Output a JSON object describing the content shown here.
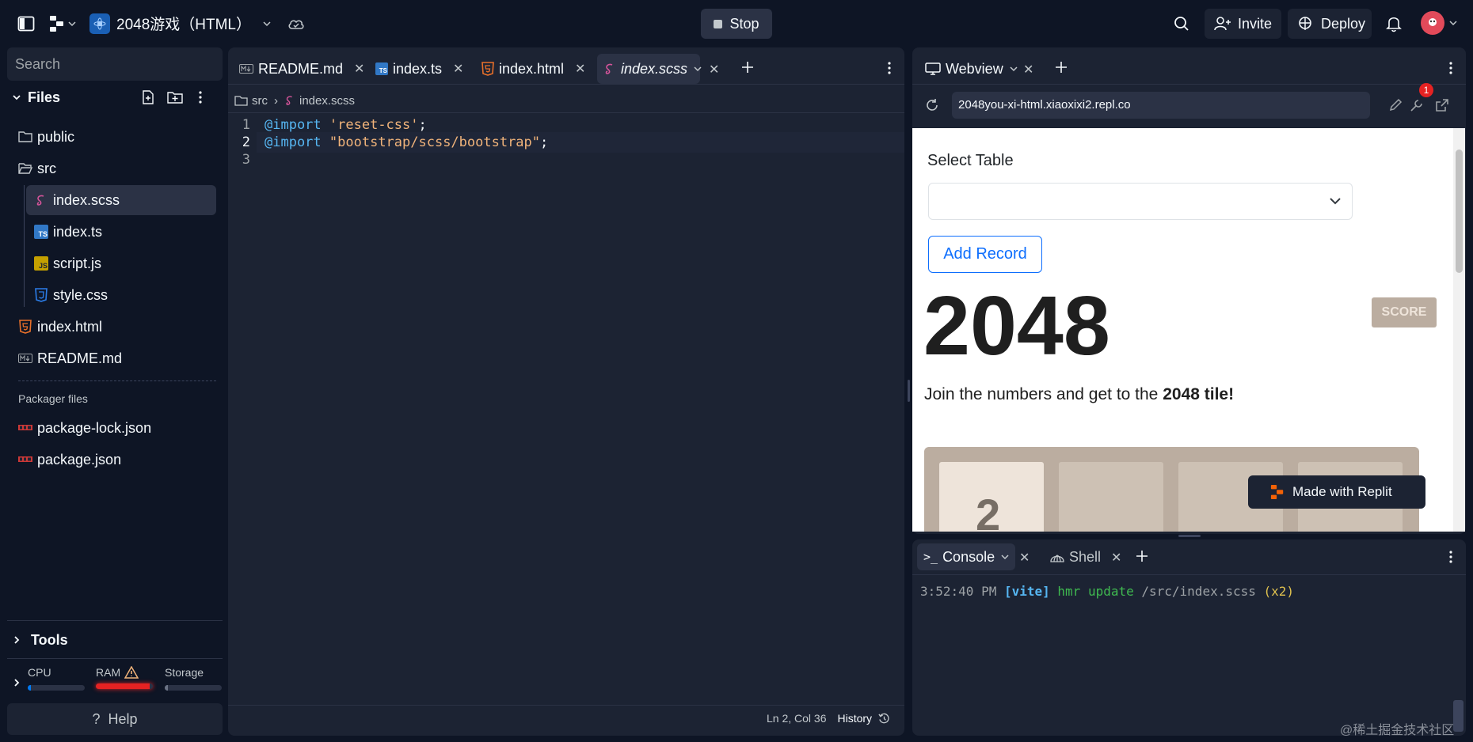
{
  "topbar": {
    "project_name": "2048游戏（HTML）",
    "stop_label": "Stop",
    "invite_label": "Invite",
    "deploy_label": "Deploy"
  },
  "sidebar": {
    "search_placeholder": "Search",
    "files_label": "Files",
    "items": [
      {
        "label": "public",
        "icon": "folder-icon"
      },
      {
        "label": "src",
        "icon": "folder-open-icon"
      },
      {
        "label": "index.scss",
        "icon": "sass-icon"
      },
      {
        "label": "index.ts",
        "icon": "typescript-icon"
      },
      {
        "label": "script.js",
        "icon": "javascript-icon"
      },
      {
        "label": "style.css",
        "icon": "css-icon"
      },
      {
        "label": "index.html",
        "icon": "html-icon"
      },
      {
        "label": "README.md",
        "icon": "markdown-icon"
      }
    ],
    "packager_label": "Packager files",
    "packager_items": [
      {
        "label": "package-lock.json",
        "icon": "npm-icon"
      },
      {
        "label": "package.json",
        "icon": "npm-icon"
      }
    ],
    "tools_label": "Tools",
    "cpu_label": "CPU",
    "ram_label": "RAM",
    "storage_label": "Storage",
    "cpu_usage": 0.06,
    "ram_usage": 0.95,
    "storage_usage": 0.05,
    "help_label": "Help"
  },
  "editor": {
    "tabs": [
      {
        "label": "README.md",
        "icon": "markdown-icon"
      },
      {
        "label": "index.ts",
        "icon": "typescript-icon"
      },
      {
        "label": "index.html",
        "icon": "html-icon"
      },
      {
        "label": "index.scss",
        "icon": "sass-icon",
        "active": true
      }
    ],
    "breadcrumb": {
      "folder": "src",
      "file": "index.scss"
    },
    "lines": [
      {
        "num": "1",
        "kw": "@import",
        "str": "'reset-css'",
        "end": ";"
      },
      {
        "num": "2",
        "kw": "@import",
        "str": "\"bootstrap/scss/bootstrap\"",
        "end": ";"
      },
      {
        "num": "3",
        "kw": "",
        "str": "",
        "end": ""
      }
    ],
    "status_position": "Ln 2, Col 36",
    "status_history": "History"
  },
  "webview": {
    "tab_label": "Webview",
    "url": "2048you-xi-html.xiaoxixi2.repl.co",
    "badge_count": "1",
    "select_label": "Select Table",
    "add_record_label": "Add Record",
    "game_title": "2048",
    "score_label": "SCORE",
    "intro_text": "Join the numbers and get to the",
    "intro_bold": "2048 tile!",
    "tile_value": "2",
    "made_with_label": "Made with Replit"
  },
  "console": {
    "tab_console": "Console",
    "tab_shell": "Shell",
    "log_time": "3:52:40 PM",
    "log_tag": "[vite]",
    "log_msg": "hmr update",
    "log_path": "/src/index.scss",
    "log_count": "(x2)"
  },
  "watermark": "@稀土掘金技术社区",
  "colors": {
    "bg": "#0e1525",
    "panel": "#1c2333",
    "accent": "#0079f2",
    "ram_warn": "#e52222",
    "kw": "#56b6f2",
    "str": "#f0b37a"
  }
}
